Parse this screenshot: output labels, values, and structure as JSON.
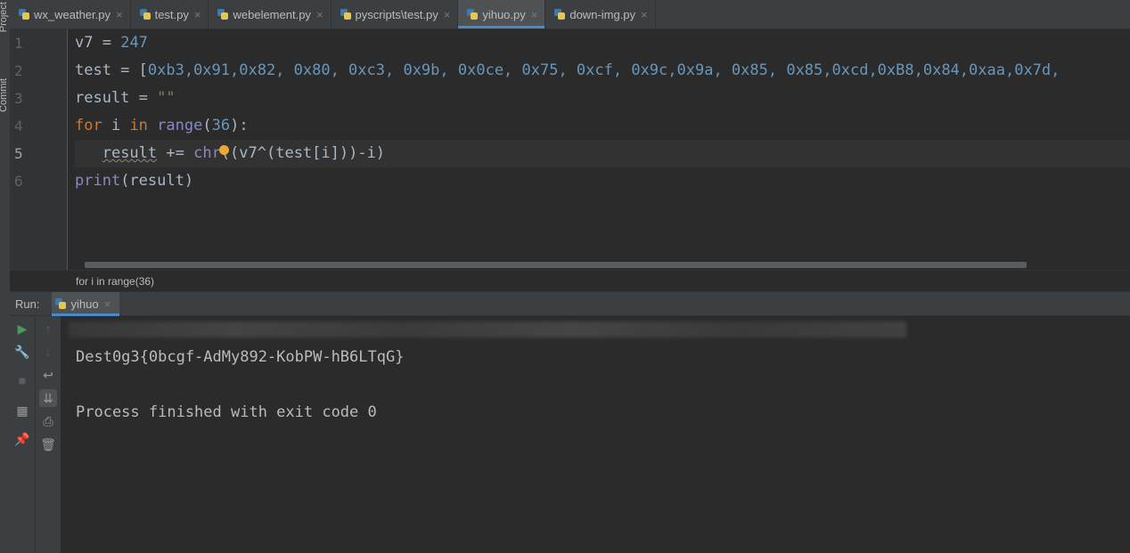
{
  "sidebar": {
    "project_label": "Project",
    "commit_label": "Commit"
  },
  "tabs": [
    {
      "label": "wx_weather.py",
      "active": false
    },
    {
      "label": "test.py",
      "active": false
    },
    {
      "label": "webelement.py",
      "active": false
    },
    {
      "label": "pyscripts\\test.py",
      "active": false
    },
    {
      "label": "yihuo.py",
      "active": true
    },
    {
      "label": "down-img.py",
      "active": false
    }
  ],
  "editor": {
    "line_numbers": [
      "1",
      "2",
      "3",
      "4",
      "5",
      "6"
    ],
    "current_line": 5,
    "code": {
      "l1_var": "v7",
      "l1_op": " = ",
      "l1_val": "247",
      "l2_prefix": "test = [",
      "l2_items": "0xb3,0x91,0x82, 0x80, 0xc3, 0x9b, 0x0ce, 0x75, 0xcf, 0x9c,0x9a, 0x85, 0x85,0xcd,0xB8,0x84,0xaa,0x7d,",
      "l3_prefix": "result = ",
      "l3_str": "\"\"",
      "l4_for": "for",
      "l4_i": " i ",
      "l4_in": "in",
      "l4_range": "range",
      "l4_open": "(",
      "l4_num": "36",
      "l4_close": "):",
      "l5_indent": "   ",
      "l5_result": "result",
      "l5_rest1": " += ",
      "l5_chr": "chr",
      "l5_rest2": "((v7^(test[i]))-i)",
      "l6_print": "print",
      "l6_args": "(result)"
    }
  },
  "breadcrumb": {
    "text": "for i in range(36)"
  },
  "run_panel": {
    "label": "Run:",
    "tab_label": "yihuo",
    "output_lines": [
      "Dest0g3{0bcgf-AdMy892-KobPW-hB6LTqG}",
      "Process finished with exit code 0"
    ]
  },
  "icons": {
    "run": "play-icon",
    "wrench": "wrench-icon",
    "stop": "stop-icon",
    "layout": "layout-icon",
    "pin": "pin-icon",
    "up": "arrow-up-icon",
    "down": "arrow-down-icon",
    "wrap": "soft-wrap-icon",
    "scroll": "scroll-to-end-icon",
    "print": "print-icon",
    "trash": "trash-icon"
  },
  "colors": {
    "keyword": "#cc7832",
    "number": "#6897bb",
    "string": "#6a8759",
    "builtin": "#8888c6",
    "accent": "#4a88c7",
    "run_green": "#499c54"
  }
}
